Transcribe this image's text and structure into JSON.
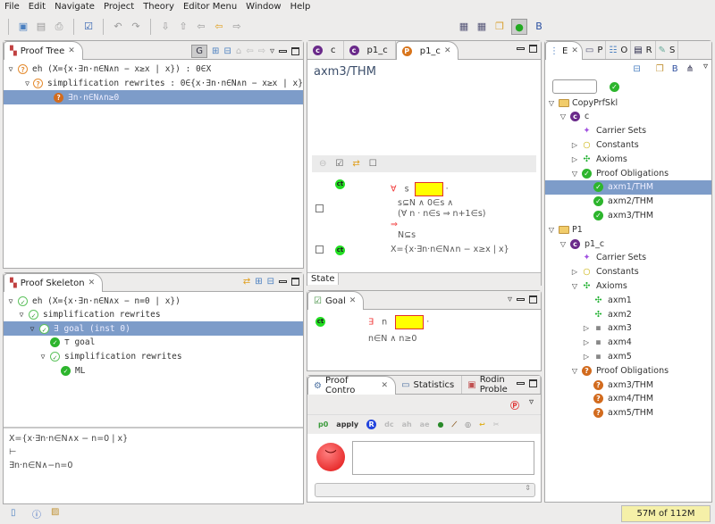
{
  "menu": [
    "File",
    "Edit",
    "Navigate",
    "Project",
    "Theory",
    "Editor Menu",
    "Window",
    "Help"
  ],
  "proof_tree": {
    "title": "Proof Tree",
    "g_button": "G",
    "rows": [
      {
        "level": 0,
        "twisty": "open",
        "icon": "question",
        "text": "eh (X={x·∃n·n∈N∧n − x≥x | x}) : 0∈X"
      },
      {
        "level": 1,
        "twisty": "open",
        "icon": "question",
        "text": "simplification rewrites : 0∈{x·∃n·n∈N∧n − x≥x | x}"
      },
      {
        "level": 2,
        "twisty": "none",
        "icon": "question-filled",
        "text": "∃n·n∈N∧n≥0",
        "selected": true
      }
    ]
  },
  "proof_skeleton": {
    "title": "Proof Skeleton",
    "rows": [
      {
        "level": 0,
        "twisty": "open",
        "icon": "check",
        "text": "eh (X={x·∃n·n∈N∧x − n=0 | x})"
      },
      {
        "level": 1,
        "twisty": "open",
        "icon": "check",
        "text": "simplification rewrites"
      },
      {
        "level": 2,
        "twisty": "open",
        "icon": "check",
        "text": "∃ goal (inst 0)",
        "selected": true
      },
      {
        "level": 3,
        "twisty": "none",
        "icon": "check-filled",
        "text": "⊤ goal"
      },
      {
        "level": 3,
        "twisty": "open",
        "icon": "check",
        "text": "simplification rewrites"
      },
      {
        "level": 4,
        "twisty": "none",
        "icon": "check-filled",
        "text": "ML"
      }
    ],
    "sequent": {
      "hyp": "X={x·∃n·n∈N∧x − n=0 | x}",
      "turnstile": "⊢",
      "goal": "∃n·n∈N∧−n=0"
    }
  },
  "editor": {
    "tabs": [
      "c",
      "p1_c",
      "p1_c"
    ],
    "title": "axm3/THM",
    "hyp1": {
      "quant": "∀",
      "var": "s",
      "dot": "·",
      "line1": "s⊆N ∧ 0∈s ∧",
      "line2": "(∀ n · n∈s ⇒ n+1∈s)",
      "implies": "⇒",
      "line3": "N⊆s"
    },
    "hyp2": "X={x·∃n·n∈N∧n − x≥x | x}",
    "ct_label": "ct",
    "state_tab": "State"
  },
  "goal": {
    "title": "Goal",
    "quant": "∃",
    "var": "n",
    "dot": "·",
    "body": "n∈N ∧ n≥0",
    "ct_label": "ct"
  },
  "proof_control": {
    "tabs": [
      "Proof Contro",
      "Statistics",
      "Rodin Proble"
    ],
    "buttons": [
      "p0",
      "apply",
      "R",
      "dc",
      "ah",
      "ae"
    ],
    "input_value": ""
  },
  "explorer": {
    "tabs": [
      "E",
      "P",
      "O",
      "R",
      "S"
    ],
    "filter_value": "",
    "rows": [
      {
        "level": 0,
        "twisty": "open",
        "icon": "folder",
        "text": "CopyPrfSkl"
      },
      {
        "level": 1,
        "twisty": "open",
        "icon": "context",
        "text": "c"
      },
      {
        "level": 2,
        "twisty": "none",
        "icon": "carrier",
        "text": "Carrier Sets"
      },
      {
        "level": 2,
        "twisty": "closed",
        "icon": "constant",
        "text": "Constants"
      },
      {
        "level": 2,
        "twisty": "closed",
        "icon": "axiom",
        "text": "Axioms"
      },
      {
        "level": 2,
        "twisty": "open",
        "icon": "check-filled",
        "text": "Proof Obligations"
      },
      {
        "level": 3,
        "twisty": "none",
        "icon": "check-filled",
        "text": "axm1/THM",
        "selected": true
      },
      {
        "level": 3,
        "twisty": "none",
        "icon": "check-filled",
        "text": "axm2/THM"
      },
      {
        "level": 3,
        "twisty": "none",
        "icon": "check-filled",
        "text": "axm3/THM"
      },
      {
        "level": 0,
        "twisty": "open",
        "icon": "folder",
        "text": "P1"
      },
      {
        "level": 1,
        "twisty": "open",
        "icon": "context",
        "text": "p1_c"
      },
      {
        "level": 2,
        "twisty": "none",
        "icon": "carrier",
        "text": "Carrier Sets"
      },
      {
        "level": 2,
        "twisty": "closed",
        "icon": "constant",
        "text": "Constants"
      },
      {
        "level": 2,
        "twisty": "open",
        "icon": "axiom",
        "text": "Axioms"
      },
      {
        "level": 3,
        "twisty": "none",
        "icon": "axiom",
        "text": "axm1"
      },
      {
        "level": 3,
        "twisty": "none",
        "icon": "axiom",
        "text": "axm2"
      },
      {
        "level": 3,
        "twisty": "closed",
        "icon": "square",
        "text": "axm3"
      },
      {
        "level": 3,
        "twisty": "closed",
        "icon": "square",
        "text": "axm4"
      },
      {
        "level": 3,
        "twisty": "closed",
        "icon": "square",
        "text": "axm5"
      },
      {
        "level": 2,
        "twisty": "open",
        "icon": "question-filled",
        "text": "Proof Obligations"
      },
      {
        "level": 3,
        "twisty": "none",
        "icon": "question-filled",
        "text": "axm3/THM"
      },
      {
        "level": 3,
        "twisty": "none",
        "icon": "question-filled",
        "text": "axm4/THM"
      },
      {
        "level": 3,
        "twisty": "none",
        "icon": "question-filled",
        "text": "axm5/THM"
      }
    ]
  },
  "status": {
    "heap": "57M of 112M"
  },
  "colors": {
    "selection": "#7d9cc9",
    "highlight": "#ffff00",
    "operator": "#f03030"
  }
}
